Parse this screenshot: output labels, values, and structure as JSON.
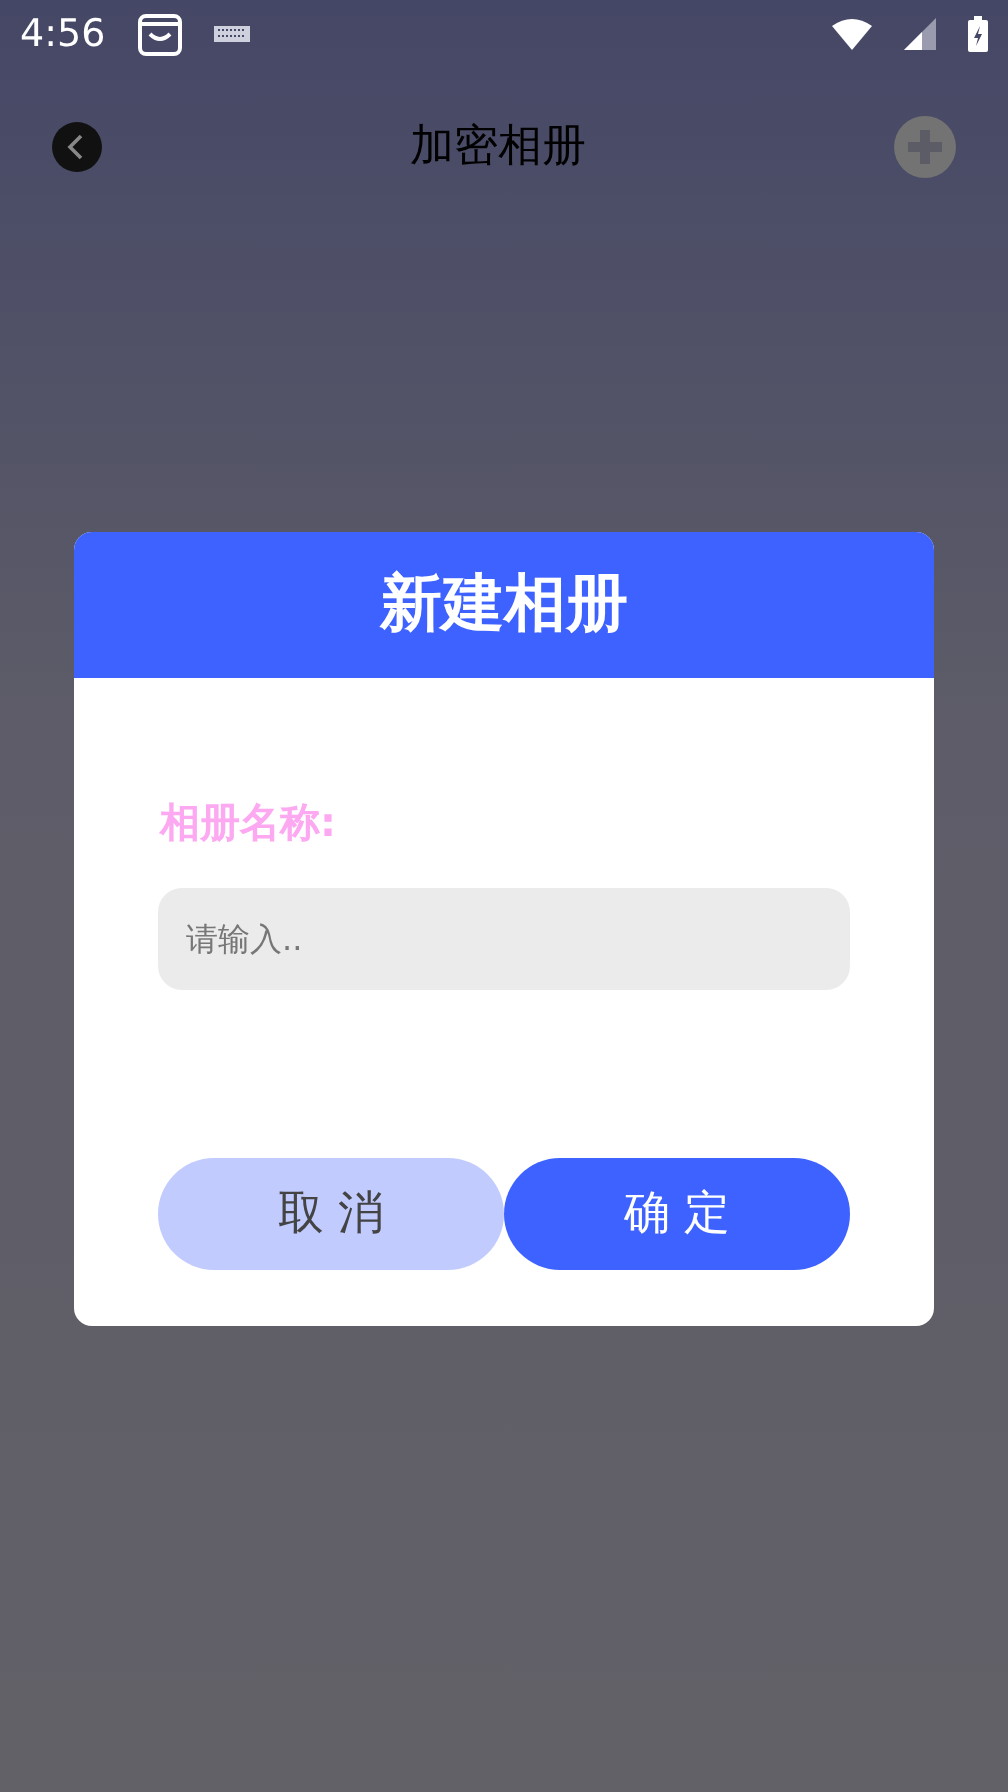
{
  "status_bar": {
    "time": "4:56"
  },
  "header": {
    "title": "加密相册"
  },
  "dialog": {
    "title": "新建相册",
    "field_label": "相册名称:",
    "placeholder": "请输入..",
    "buttons": [
      {
        "kind": "cancel",
        "label": "取 消"
      },
      {
        "kind": "confirm",
        "label": "确 定"
      }
    ]
  }
}
